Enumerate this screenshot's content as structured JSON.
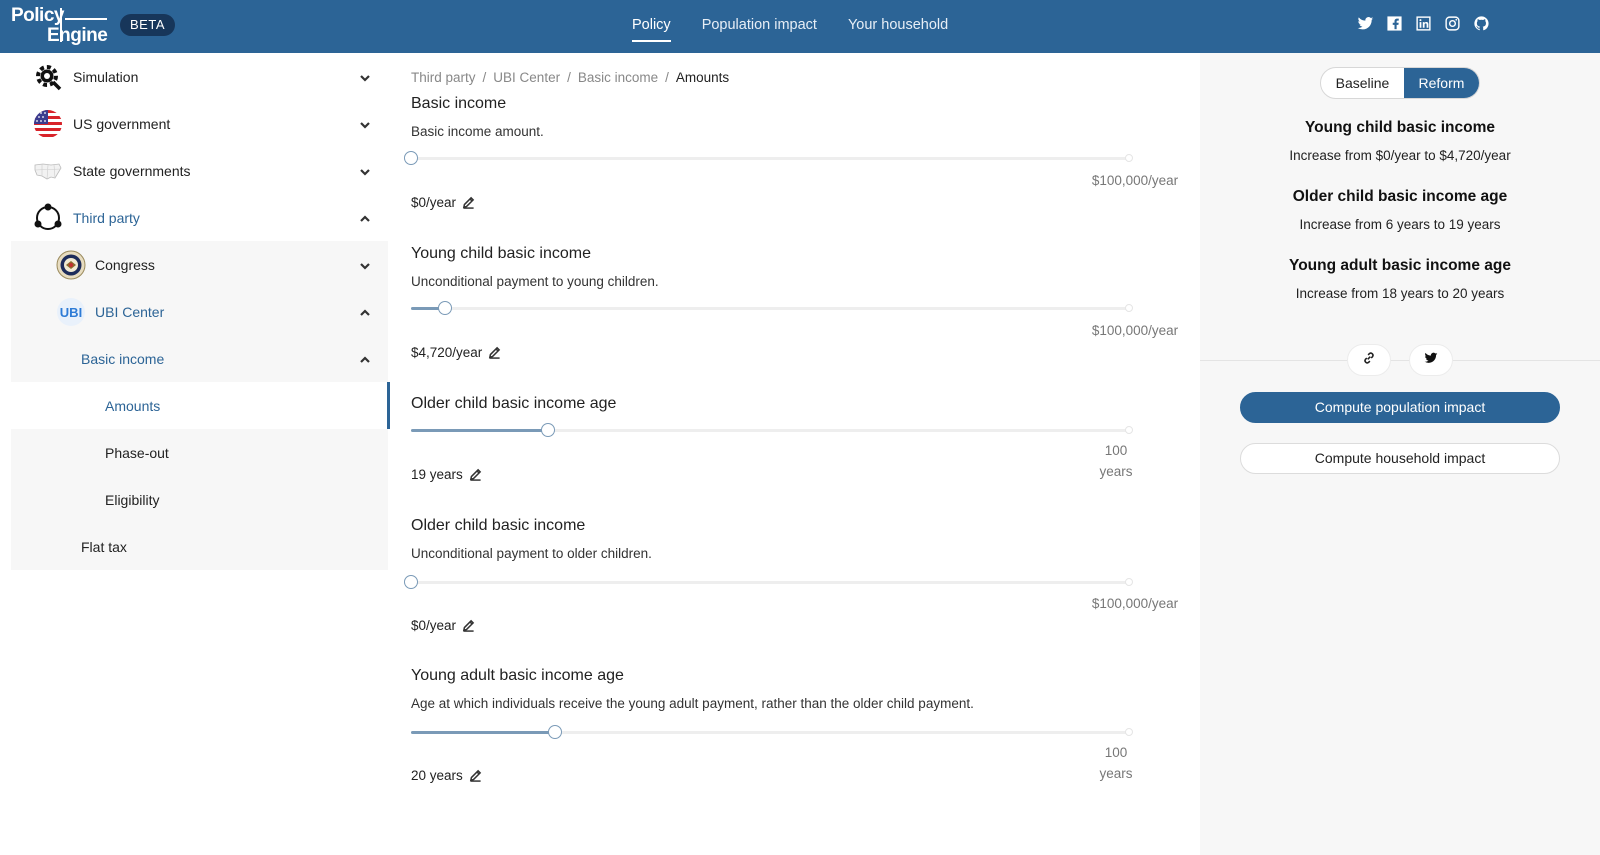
{
  "header": {
    "logo_line1": "Policy",
    "logo_line2": "Engine",
    "beta": "BETA",
    "nav": [
      {
        "label": "Policy",
        "active": true
      },
      {
        "label": "Population impact",
        "active": false
      },
      {
        "label": "Your household",
        "active": false
      }
    ],
    "social_icons": [
      "twitter-icon",
      "facebook-icon",
      "linkedin-icon",
      "instagram-icon",
      "github-icon"
    ]
  },
  "sidebar": {
    "items": [
      {
        "label": "Simulation",
        "icon": "gear-icon",
        "state": "collapsed"
      },
      {
        "label": "US government",
        "icon": "us-flag-icon",
        "state": "collapsed"
      },
      {
        "label": "State governments",
        "icon": "us-map-icon",
        "state": "collapsed"
      },
      {
        "label": "Third party",
        "icon": "network-icon",
        "state": "expanded"
      },
      {
        "label": "Congress",
        "icon": "congress-seal-icon",
        "state": "collapsed"
      },
      {
        "label": "UBI Center",
        "icon": "ubi-logo-icon",
        "icon_text": "UBI",
        "state": "expanded"
      },
      {
        "label": "Basic income",
        "state": "expanded"
      },
      {
        "label": "Amounts",
        "state": "selected"
      },
      {
        "label": "Phase-out"
      },
      {
        "label": "Eligibility"
      },
      {
        "label": "Flat tax"
      }
    ]
  },
  "breadcrumb": [
    "Third party",
    "UBI Center",
    "Basic income",
    "Amounts"
  ],
  "breadcrumb_sep": "/",
  "parameters": [
    {
      "title": "Basic income",
      "description": "Basic income amount.",
      "value": "$0/year",
      "fraction": 0.0,
      "max_label": "$100,000/year"
    },
    {
      "title": "Young child basic income",
      "description": "Unconditional payment to young children.",
      "value": "$4,720/year",
      "fraction": 0.0472,
      "max_label": "$100,000/year"
    },
    {
      "title": "Older child basic income age",
      "description": "",
      "value": "19 years",
      "fraction": 0.19,
      "max_label": "100 years"
    },
    {
      "title": "Older child basic income",
      "description": "Unconditional payment to older children.",
      "value": "$0/year",
      "fraction": 0.0,
      "max_label": "$100,000/year"
    },
    {
      "title": "Young adult basic income age",
      "description": "Age at which individuals receive the young adult payment, rather than the older child payment.",
      "value": "20 years",
      "fraction": 0.2,
      "max_label": "100 years"
    }
  ],
  "right_panel": {
    "toggle": {
      "baseline": "Baseline",
      "reform": "Reform",
      "selected": "Reform"
    },
    "changes": [
      {
        "title": "Young child basic income",
        "detail": "Increase from $0/year to $4,720/year"
      },
      {
        "title": "Older child basic income age",
        "detail": "Increase from 6 years to 19 years"
      },
      {
        "title": "Young adult basic income age",
        "detail": "Increase from 18 years to 20 years"
      }
    ],
    "share_icons": [
      "link-icon",
      "twitter-icon"
    ],
    "compute_population": "Compute population impact",
    "compute_household": "Compute household impact"
  },
  "colors": {
    "brand": "#2c6496",
    "slider": "#7a9ab7"
  }
}
